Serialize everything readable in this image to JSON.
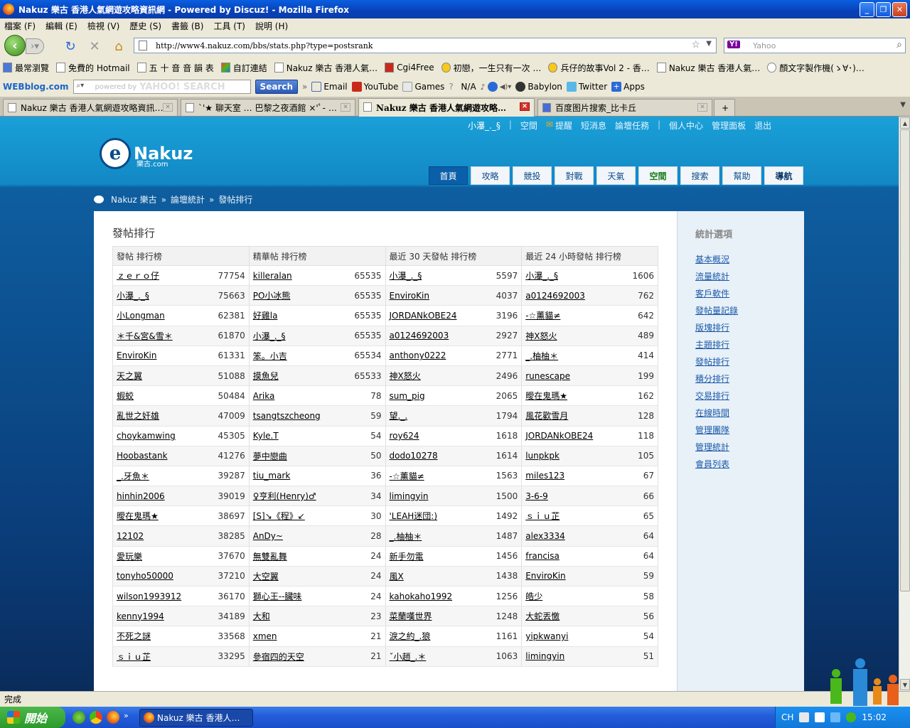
{
  "window": {
    "title": "Nakuz 樂古 香港人氣網遊攻略資訊網 - Powered by Discuz! - Mozilla Firefox"
  },
  "menu": [
    "檔案 (F)",
    "編輯 (E)",
    "檢視 (V)",
    "歷史 (S)",
    "書籤 (B)",
    "工具 (T)",
    "說明 (H)"
  ],
  "nav": {
    "url": "http://www4.nakuz.com/bbs/stats.php?type=postsrank",
    "search_placeholder": "Yahoo",
    "search_engine": "Y!"
  },
  "bookmarks": [
    "最常瀏覽",
    "免費的 Hotmail",
    "五 十 音 音 韻 表",
    "自訂連結",
    "Nakuz 樂古 香港人氣…",
    "Cgi4Free",
    "初戀，一生只有一次 …",
    "兵仔的故事Vol 2 - 香…",
    "Nakuz 樂古 香港人氣…",
    "顏文字製作機(ゝ∀･)…"
  ],
  "toolbar2": {
    "brand": "WEBblog.com",
    "search_hint": "powered by",
    "yahoo": "YAHOO! SEARCH",
    "search_btn": "Search",
    "items": [
      "Email",
      "YouTube",
      "Games",
      "N/A",
      "Babylon",
      "Twitter",
      "Apps"
    ]
  },
  "tabs": [
    {
      "label": "Nakuz 樂古 香港人氣網遊攻略資訊…",
      "active": false
    },
    {
      "label": "`'★ 聊天室 … 巴黎之夜酒館 ×'ﾟ- …",
      "active": false
    },
    {
      "label": "Nakuz 樂古 香港人氣網遊攻略…",
      "active": true
    },
    {
      "label": "百度图片搜索_比卡丘",
      "active": false
    }
  ],
  "site": {
    "toplinks": {
      "user": "小瀑_._§",
      "items": [
        "空間",
        "提醒",
        "短消息",
        "論壇任務",
        "個人中心",
        "管理面板",
        "退出"
      ]
    },
    "logo": {
      "word": "Nakuz",
      "sub": "樂古.com",
      "mark": "e"
    },
    "mainnav": [
      "首頁",
      "攻略",
      "競投",
      "對戰",
      "天氣",
      "空間",
      "搜索",
      "幫助",
      "導航"
    ],
    "breadcrumb": [
      "Nakuz 樂古",
      "論壇統計",
      "發帖排行"
    ],
    "page_title": "發帖排行",
    "columns": [
      "發帖 排行榜",
      "精華帖 排行榜",
      "最近 30 天發帖 排行榜",
      "最近 24 小時發帖 排行榜"
    ],
    "sidebar": {
      "title": "統計選項",
      "items": [
        "基本概況",
        "流量統計",
        "客戶軟件",
        "發帖量記錄",
        "版塊排行",
        "主題排行",
        "發帖排行",
        "積分排行",
        "交易排行",
        "在線時間",
        "管理團隊",
        "管理統計",
        "會員列表"
      ]
    }
  },
  "ranks": [
    [
      [
        "ｚｅｒｏ仔",
        "77754"
      ],
      [
        "killeralan",
        "65535"
      ],
      [
        "小瀑_._§",
        "5597"
      ],
      [
        "小瀑_._§",
        "1606"
      ]
    ],
    [
      [
        "小瀑_._§",
        "75663"
      ],
      [
        "PO小冰熊",
        "65535"
      ],
      [
        "EnviroKin",
        "4037"
      ],
      [
        "a0124692003",
        "762"
      ]
    ],
    [
      [
        "小Longman",
        "62381"
      ],
      [
        "好雞la",
        "65535"
      ],
      [
        "JORDANkOBE24",
        "3196"
      ],
      [
        "-☆薰貓≠",
        "642"
      ]
    ],
    [
      [
        "＊千&宮&雪＊",
        "61870"
      ],
      [
        "小瀑_._§",
        "65535"
      ],
      [
        "a0124692003",
        "2927"
      ],
      [
        "神X怒火",
        "489"
      ]
    ],
    [
      [
        "EnviroKin",
        "61331"
      ],
      [
        "笨。小吉",
        "65534"
      ],
      [
        "anthony0222",
        "2771"
      ],
      [
        "_.柚柚＊",
        "414"
      ]
    ],
    [
      [
        "天之翼",
        "51088"
      ],
      [
        "摸魚兒",
        "65533"
      ],
      [
        "神X怒火",
        "2496"
      ],
      [
        "runescape",
        "199"
      ]
    ],
    [
      [
        "蝦蛟",
        "50484"
      ],
      [
        "Arika",
        "78"
      ],
      [
        "sum_pig",
        "2065"
      ],
      [
        "曖在鬼瑪★",
        "162"
      ]
    ],
    [
      [
        "亂世之奸雄",
        "47009"
      ],
      [
        "tsangtszcheong",
        "59"
      ],
      [
        "望._.",
        "1794"
      ],
      [
        "風花歡雪月",
        "128"
      ]
    ],
    [
      [
        "choykamwing",
        "45305"
      ],
      [
        "Kyle.T",
        "54"
      ],
      [
        "roy624",
        "1618"
      ],
      [
        "JORDANkOBE24",
        "118"
      ]
    ],
    [
      [
        "Hoobastank",
        "41276"
      ],
      [
        "夢中戀曲",
        "50"
      ],
      [
        "dodo10278",
        "1614"
      ],
      [
        "lunpkpk",
        "105"
      ]
    ],
    [
      [
        "_.牙魚＊",
        "39287"
      ],
      [
        "tiu_mark",
        "36"
      ],
      [
        "-☆薰貓≠",
        "1563"
      ],
      [
        "miles123",
        "67"
      ]
    ],
    [
      [
        "hinhin2006",
        "39019"
      ],
      [
        "♀亨利(Henry)♂",
        "34"
      ],
      [
        "limingyin",
        "1500"
      ],
      [
        "3-6-9",
        "66"
      ]
    ],
    [
      [
        "曖在鬼瑪★",
        "38697"
      ],
      [
        "[S]↘《程》↙",
        "30"
      ],
      [
        "'LEAH迷団:)",
        "1492"
      ],
      [
        "ｓｉｕ芷",
        "65"
      ]
    ],
    [
      [
        "12102",
        "38285"
      ],
      [
        "AnDy~",
        "28"
      ],
      [
        "_.柚柚＊",
        "1487"
      ],
      [
        "alex3334",
        "64"
      ]
    ],
    [
      [
        "愛玩樂",
        "37670"
      ],
      [
        "無雙亂舞",
        "24"
      ],
      [
        "新手勿電",
        "1456"
      ],
      [
        "francisa",
        "64"
      ]
    ],
    [
      [
        "tonyho50000",
        "37210"
      ],
      [
        "大空翼",
        "24"
      ],
      [
        "風X",
        "1438"
      ],
      [
        "EnviroKin",
        "59"
      ]
    ],
    [
      [
        "wilson1993912",
        "36170"
      ],
      [
        "獅心王--臟味",
        "24"
      ],
      [
        "kahokaho1992",
        "1256"
      ],
      [
        "皓少",
        "58"
      ]
    ],
    [
      [
        "kenny1994",
        "34189"
      ],
      [
        "大和",
        "23"
      ],
      [
        "菜蘭嘆世界",
        "1248"
      ],
      [
        "大蛇丟憿",
        "56"
      ]
    ],
    [
      [
        "不死之謎",
        "33568"
      ],
      [
        "xmen",
        "21"
      ],
      [
        "淚之約_.狼",
        "1161"
      ],
      [
        "yipkwanyi",
        "54"
      ]
    ],
    [
      [
        "ｓｉｕ芷",
        "33295"
      ],
      [
        "參宿四的天空",
        "21"
      ],
      [
        "ˇ小趙_.＊",
        "1063"
      ],
      [
        "limingyin",
        "51"
      ]
    ]
  ],
  "status": "完成",
  "taskbar": {
    "start": "開始",
    "task": "Nakuz 樂古 香港人…",
    "tray_lang": "CH",
    "clock": "15:02"
  }
}
